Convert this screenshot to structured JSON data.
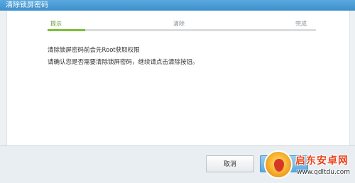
{
  "window": {
    "title": "清除锁屏密码"
  },
  "steps": {
    "items": [
      {
        "label": "提示",
        "active": true
      },
      {
        "label": "清除",
        "active": false
      },
      {
        "label": "完成",
        "active": false
      }
    ],
    "progress_fraction": 0.14
  },
  "message": {
    "line1": "清除锁屏密码前会先Root获取权限",
    "line2": "请确认您是否需要清除锁屏密码，继续请点击清除按钮。"
  },
  "footer": {
    "cancel_label": "取消"
  },
  "watermark": {
    "title": "启东安卓网",
    "url": "www.qdltdu.com"
  },
  "colors": {
    "accent": "#7cbf3b",
    "titlebar": "#4a9bd6"
  }
}
